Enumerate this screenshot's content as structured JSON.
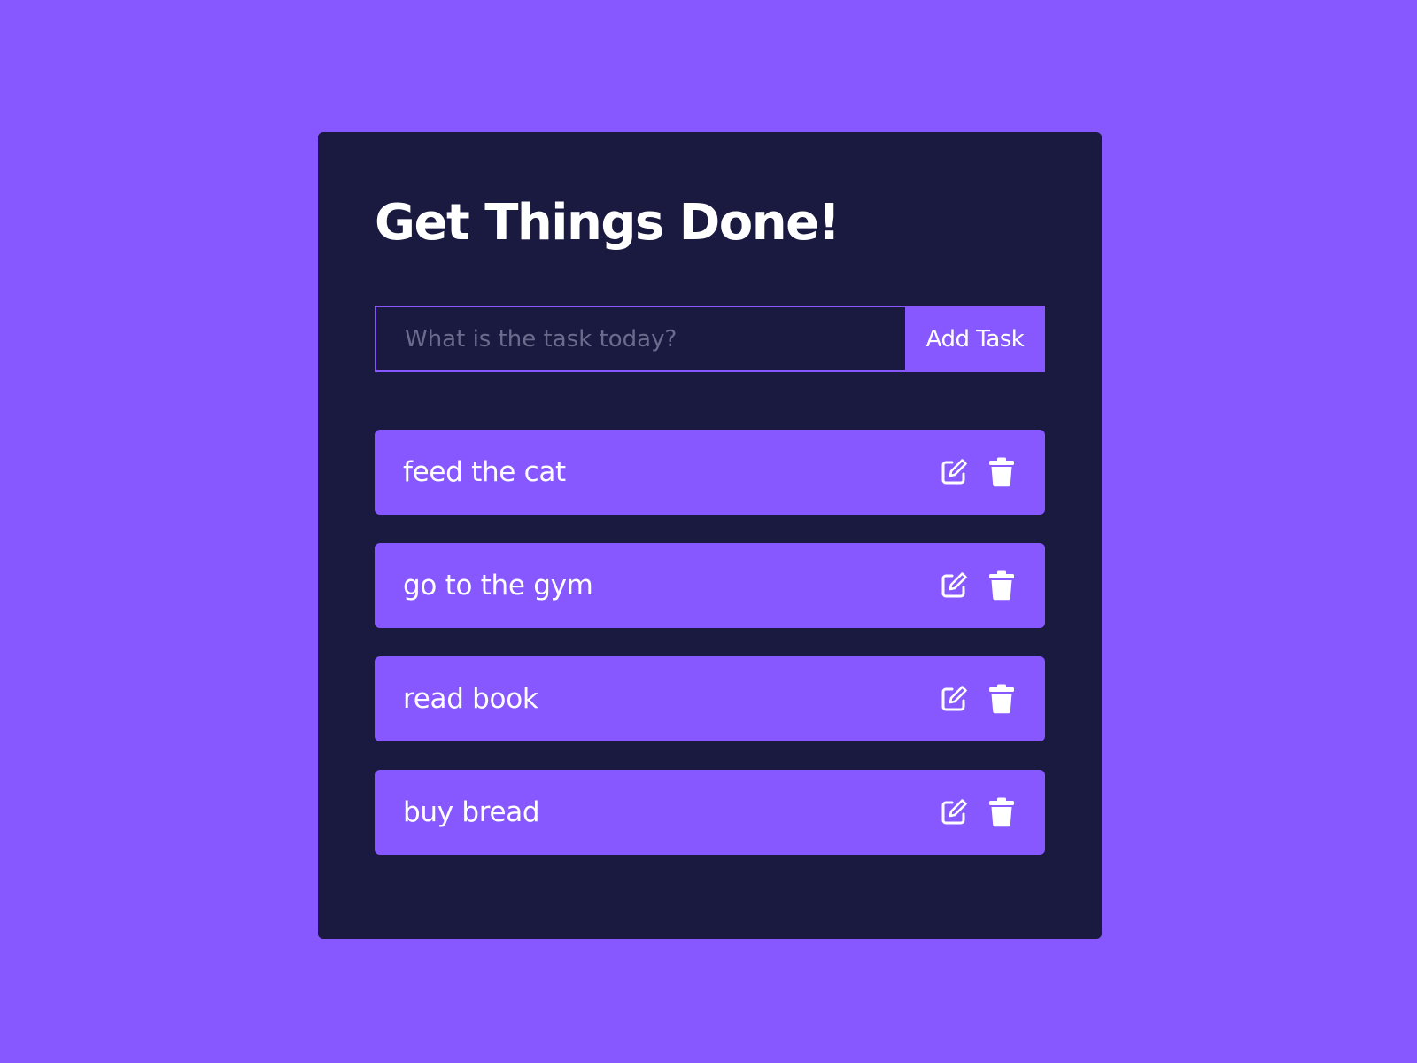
{
  "app": {
    "title": "Get Things Done!"
  },
  "form": {
    "input_value": "",
    "input_placeholder": "What is the task today?",
    "add_button_label": "Add Task"
  },
  "todos": [
    {
      "text": "feed the cat",
      "edit_icon": "edit-icon",
      "delete_icon": "trash-icon"
    },
    {
      "text": "go to the gym",
      "edit_icon": "edit-icon",
      "delete_icon": "trash-icon"
    },
    {
      "text": "read book",
      "edit_icon": "edit-icon",
      "delete_icon": "trash-icon"
    },
    {
      "text": "buy bread",
      "edit_icon": "edit-icon",
      "delete_icon": "trash-icon"
    }
  ],
  "colors": {
    "background": "#8758ff",
    "card": "#1a1a40",
    "accent": "#8758ff",
    "text": "#ffffff",
    "placeholder": "#6b6b8d"
  }
}
